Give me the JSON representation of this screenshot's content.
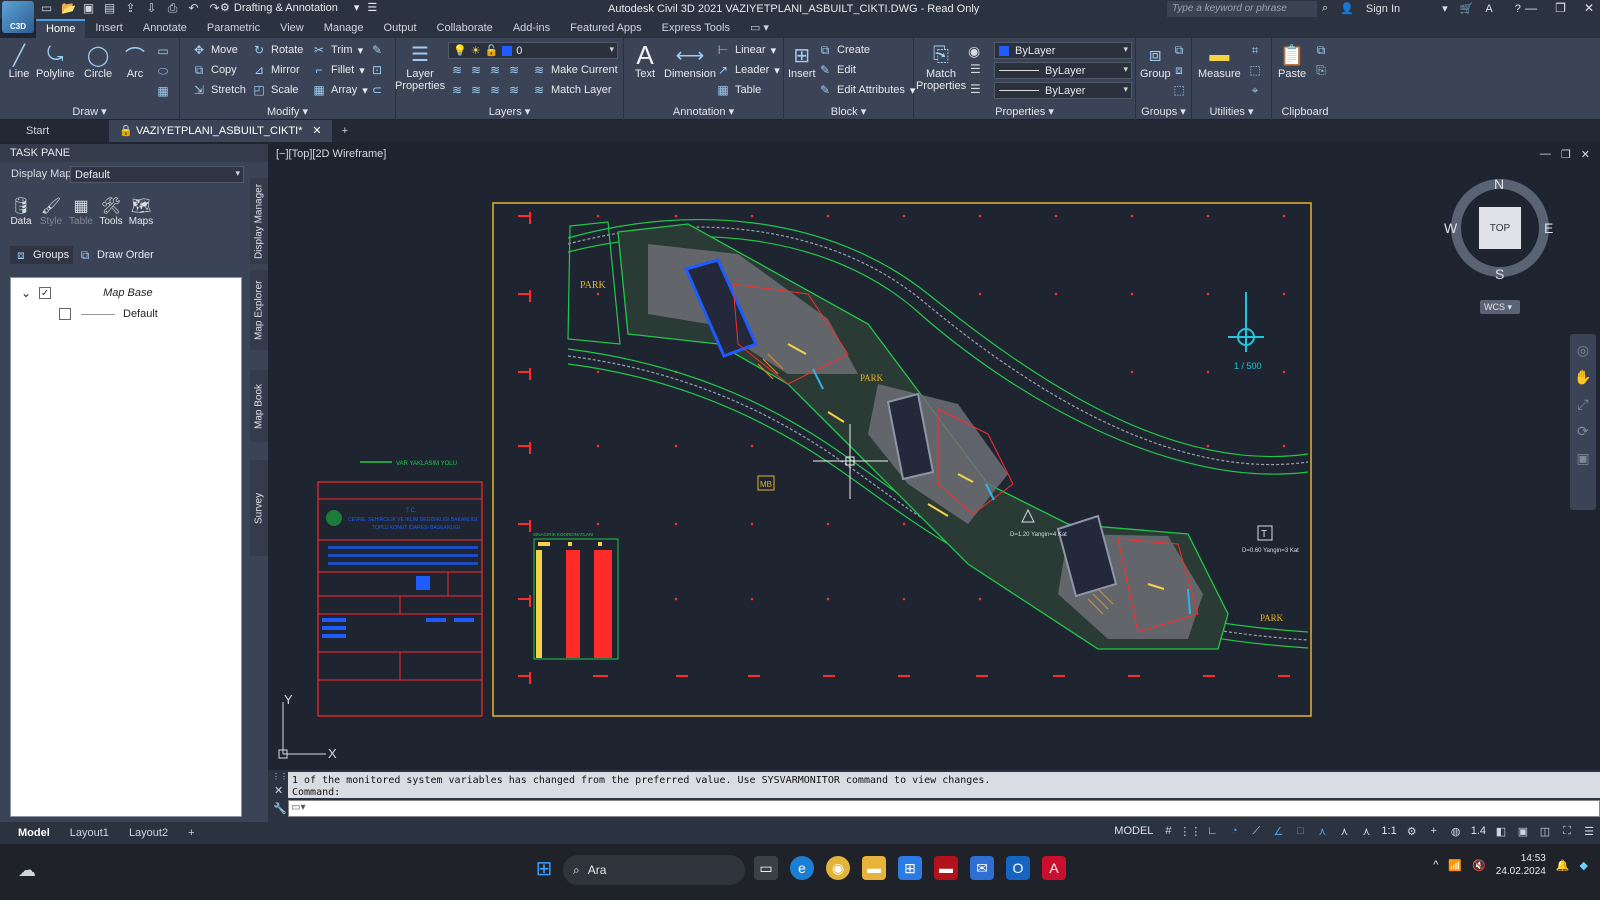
{
  "titlebar": {
    "logo": "C3D",
    "workspace": "Drafting & Annotation",
    "title": "Autodesk Civil 3D 2021    VAZIYETPLANI_ASBUILT_CIKTI.DWG - Read Only",
    "search_placeholder": "Type a keyword or phrase",
    "sign_in": "Sign In"
  },
  "menu_tabs": [
    "Home",
    "Insert",
    "Annotate",
    "Parametric",
    "View",
    "Manage",
    "Output",
    "Collaborate",
    "Add-ins",
    "Featured Apps",
    "Express Tools"
  ],
  "ribbon": {
    "draw": {
      "title": "Draw",
      "line": "Line",
      "polyline": "Polyline",
      "circle": "Circle",
      "arc": "Arc"
    },
    "modify": {
      "title": "Modify",
      "move": "Move",
      "rotate": "Rotate",
      "trim": "Trim",
      "copy": "Copy",
      "mirror": "Mirror",
      "fillet": "Fillet",
      "stretch": "Stretch",
      "scale": "Scale",
      "array": "Array"
    },
    "layers": {
      "title": "Layers",
      "layer_properties": "Layer Properties",
      "current_layer": "0",
      "make_current": "Make Current",
      "match_layer": "Match Layer"
    },
    "annotation": {
      "title": "Annotation",
      "text": "Text",
      "dimension": "Dimension",
      "linear": "Linear",
      "leader": "Leader",
      "table": "Table"
    },
    "block": {
      "title": "Block",
      "insert": "Insert",
      "create": "Create",
      "edit": "Edit",
      "edit_attributes": "Edit Attributes"
    },
    "properties": {
      "title": "Properties",
      "match_properties": "Match Properties",
      "color": "ByLayer",
      "linetype": "ByLayer",
      "lineweight": "ByLayer"
    },
    "groups": {
      "title": "Groups",
      "group": "Group"
    },
    "utilities": {
      "title": "Utilities",
      "measure": "Measure"
    },
    "clipboard": {
      "title": "Clipboard",
      "paste": "Paste"
    }
  },
  "file_tabs": {
    "start": "Start",
    "active": "VAZIYETPLANI_ASBUILT_CIKTI*"
  },
  "task_pane": {
    "title": "TASK PANE",
    "display_map_label": "Display Map:",
    "display_map_value": "Default",
    "tools": [
      "Data",
      "Style",
      "Table",
      "Tools",
      "Maps"
    ],
    "groups_label": "Groups",
    "draw_order_label": "Draw Order",
    "tree": {
      "map_base": "Map Base",
      "default": "Default"
    },
    "vertical_tabs": [
      "Display Manager",
      "Map Explorer",
      "Map Book",
      "Survey"
    ]
  },
  "viewport": {
    "label": "[−][Top][2D Wireframe]",
    "drawing_texts": {
      "park1": "PARK",
      "park2": "PARK",
      "park3": "PARK",
      "scale": "1 / 500",
      "legend_title": "VAR YAKLASIM YOLU",
      "chart_title": "SINAGIRIK KOORDINATLARI",
      "title_block_1": "T.C.",
      "title_block_2": "CEVRE, SEHIRCILIK VE IKLIM DEGISIKLIGI BAKANLIGI",
      "title_block_3": "TOPLU KONUT IDARESI BASKANLIGI",
      "mb": "MB",
      "triangle_note": "D=1.20 Yangin=4 Kat",
      "t_note": "D=0.60 Yangin=3 Kat",
      "t_letter": "T"
    }
  },
  "navcube": {
    "n": "N",
    "s": "S",
    "e": "E",
    "w": "W",
    "face": "TOP",
    "wcs": "WCS"
  },
  "ucs": {
    "x": "X",
    "y": "Y"
  },
  "command": {
    "history": "1 of the monitored system variables has changed from the preferred value. Use SYSVARMONITOR command to view changes.",
    "prompt": "Command:"
  },
  "layout_tabs": [
    "Model",
    "Layout1",
    "Layout2"
  ],
  "status": {
    "model": "MODEL",
    "scale": "1:1",
    "decimal": "1.4"
  },
  "taskbar": {
    "search": "Ara",
    "time": "14:53",
    "date": "24.02.2024"
  },
  "colors": {
    "accent": "#4aa0e6",
    "drawing_bg": "#1e2430",
    "frame": "#e6b42a",
    "red": "#ff2a2a",
    "green": "#22c84a"
  }
}
